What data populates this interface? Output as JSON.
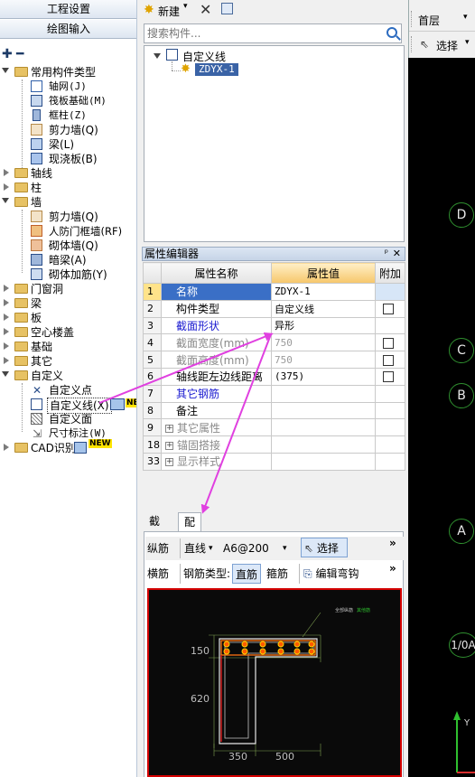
{
  "left": {
    "header1": "工程设置",
    "header2": "绘图输入",
    "tree": [
      {
        "label": "常用构件类型",
        "kind": "folder-open"
      },
      {
        "label": "轴网(J)",
        "kind": "item"
      },
      {
        "label": "筏板基础(M)",
        "kind": "item"
      },
      {
        "label": "框柱(Z)",
        "kind": "item"
      },
      {
        "label": "剪力墙(Q)",
        "kind": "item"
      },
      {
        "label": "梁(L)",
        "kind": "item"
      },
      {
        "label": "现浇板(B)",
        "kind": "item"
      },
      {
        "label": "轴线",
        "kind": "folder"
      },
      {
        "label": "柱",
        "kind": "folder"
      },
      {
        "label": "墙",
        "kind": "folder-open"
      },
      {
        "label": "剪力墙(Q)",
        "kind": "item"
      },
      {
        "label": "人防门框墙(RF)",
        "kind": "item"
      },
      {
        "label": "砌体墙(Q)",
        "kind": "item"
      },
      {
        "label": "暗梁(A)",
        "kind": "item"
      },
      {
        "label": "砌体加筋(Y)",
        "kind": "item"
      },
      {
        "label": "门窗洞",
        "kind": "folder"
      },
      {
        "label": "梁",
        "kind": "folder"
      },
      {
        "label": "板",
        "kind": "folder"
      },
      {
        "label": "空心楼盖",
        "kind": "folder"
      },
      {
        "label": "基础",
        "kind": "folder"
      },
      {
        "label": "其它",
        "kind": "folder"
      },
      {
        "label": "自定义",
        "kind": "folder-open"
      },
      {
        "label": "自定义点",
        "kind": "item"
      },
      {
        "label": "自定义线(X)",
        "kind": "item-selected"
      },
      {
        "label": "自定义面",
        "kind": "item"
      },
      {
        "label": "尺寸标注(W)",
        "kind": "item"
      },
      {
        "label": "CAD识别",
        "kind": "folder"
      }
    ],
    "new_tag": "NEW",
    "new_tag_short": "NE"
  },
  "mid": {
    "new_label": "新建",
    "search_placeholder": "搜索构件...",
    "comp_root": "自定义线",
    "comp_child": "ZDYX-1",
    "prop_title": "属性编辑器",
    "prop_headers": {
      "name": "属性名称",
      "value": "属性值",
      "extra": "附加"
    },
    "props": [
      {
        "num": "1",
        "name": "名称",
        "value": "ZDYX-1",
        "style": "blue",
        "check": false,
        "selected": true
      },
      {
        "num": "2",
        "name": "构件类型",
        "value": "自定义线",
        "style": "",
        "check": true
      },
      {
        "num": "3",
        "name": "截面形状",
        "value": "异形",
        "style": "blue",
        "check": false
      },
      {
        "num": "4",
        "name": "截面宽度(mm)",
        "value": "750",
        "style": "grey",
        "check": true
      },
      {
        "num": "5",
        "name": "截面高度(mm)",
        "value": "750",
        "style": "grey",
        "check": true
      },
      {
        "num": "6",
        "name": "轴线距左边线距离",
        "value": "(375)",
        "style": "",
        "check": true
      },
      {
        "num": "7",
        "name": "其它钢筋",
        "value": "",
        "style": "blue",
        "check": false
      },
      {
        "num": "8",
        "name": "备注",
        "value": "",
        "style": "",
        "check": false
      },
      {
        "num": "9",
        "name": "其它属性",
        "value": "",
        "style": "grey",
        "expand": true
      },
      {
        "num": "18",
        "name": "锚固搭接",
        "value": "",
        "style": "grey",
        "expand": true
      },
      {
        "num": "33",
        "name": "显示样式",
        "value": "",
        "style": "grey",
        "expand": true
      }
    ],
    "tabs": [
      "截面",
      "配筋"
    ],
    "rebar_bar": {
      "longitudinal": "纵筋",
      "line_type": "直线",
      "spec": "A6@200",
      "select": "选择",
      "more": "»"
    },
    "rebar_bar2": {
      "transverse": "横筋",
      "type_label": "钢筋类型:",
      "straight": "直筋",
      "stirrup": "箍筋",
      "edit_hook": "编辑弯钩",
      "more": "»"
    },
    "preview": {
      "dim_top": "150",
      "dim_left": "620",
      "dim_bottom_left": "350",
      "dim_bottom_right": "500",
      "legend_a": "全部纵筋",
      "legend_b": "其他筋"
    }
  },
  "right": {
    "floor": "首层",
    "select": "选择",
    "axes": [
      "D",
      "C",
      "B",
      "A",
      "1/0A"
    ]
  },
  "colors": {
    "selection": "#3a63a6",
    "accent": "#e040e0",
    "cad_green": "#2f8f2f",
    "preview_border": "#d40000"
  }
}
